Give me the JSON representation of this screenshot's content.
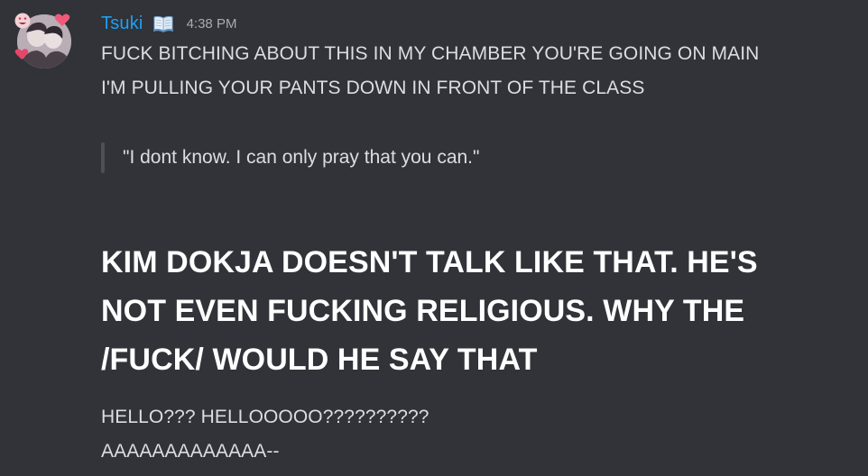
{
  "message": {
    "author": "Tsuki",
    "author_badge_icon": "open-book-icon",
    "timestamp": "4:38 PM",
    "colors": {
      "background": "#313338",
      "username": "#1e9ff5",
      "text": "#dbdee1",
      "heading": "#ffffff",
      "timestamp": "#a8aab0",
      "quote_bar": "#4e5058"
    },
    "lines": [
      "FUCK BITCHING ABOUT THIS IN MY CHAMBER YOU'RE GOING ON MAIN",
      "I'M PULLING YOUR PANTS DOWN IN FRONT OF THE CLASS"
    ],
    "quote": "\"I dont know. I can only pray that you can.\"",
    "heading_lines": [
      "KIM DOKJA DOESN'T TALK LIKE THAT. HE'S",
      "NOT EVEN FUCKING RELIGIOUS. WHY THE",
      "/FUCK/ WOULD HE SAY THAT"
    ],
    "after_lines": [
      "HELLO??? HELLOOOOO??????????",
      "AAAAAAAAAAAAA--"
    ]
  }
}
